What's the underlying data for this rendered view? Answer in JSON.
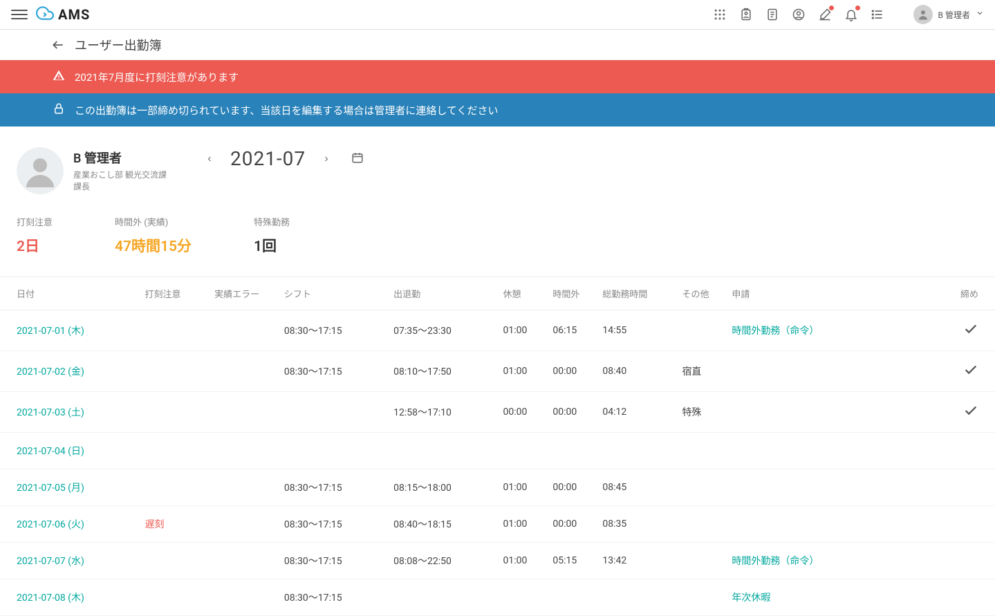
{
  "brand": "AMS",
  "header": {
    "user_name": "B 管理者"
  },
  "page": {
    "title": "ユーザー出勤簿"
  },
  "alerts": {
    "warning": "2021年7月度に打刻注意があります",
    "info": "この出勤簿は一部締め切られています、当該日を編集する場合は管理者に連絡してください"
  },
  "profile": {
    "name": "B 管理者",
    "dept_line1": "産業おこし部 観光交流課",
    "dept_line2": "課長"
  },
  "month": "2021-07",
  "stats": {
    "attention": {
      "label": "打刻注意",
      "value": "2日"
    },
    "overtime": {
      "label": "時間外 (実績)",
      "value": "47時間15分"
    },
    "special": {
      "label": "特殊勤務",
      "value": "1回"
    }
  },
  "columns": {
    "date": "日付",
    "attention": "打刻注意",
    "error": "実績エラー",
    "shift": "シフト",
    "inout": "出退勤",
    "break": "休憩",
    "overtime": "時間外",
    "total": "総勤務時間",
    "other": "その他",
    "application": "申請",
    "close": "締め"
  },
  "rows": [
    {
      "date": "2021-07-01 (木)",
      "attention": "",
      "error": "",
      "shift": "08:30～17:15",
      "inout": "07:35～23:30",
      "break": "01:00",
      "overtime": "06:15",
      "total": "14:55",
      "other": "",
      "application": "時間外勤務（命令）",
      "closed": true
    },
    {
      "date": "2021-07-02 (金)",
      "attention": "",
      "error": "",
      "shift": "08:30～17:15",
      "inout": "08:10～17:50",
      "break": "01:00",
      "overtime": "00:00",
      "total": "08:40",
      "other": "宿直",
      "application": "",
      "closed": true
    },
    {
      "date": "2021-07-03 (土)",
      "attention": "",
      "error": "",
      "shift": "",
      "inout": "12:58～17:10",
      "break": "00:00",
      "overtime": "00:00",
      "total": "04:12",
      "other": "特殊",
      "application": "",
      "closed": true
    },
    {
      "date": "2021-07-04 (日)",
      "attention": "",
      "error": "",
      "shift": "",
      "inout": "",
      "break": "",
      "overtime": "",
      "total": "",
      "other": "",
      "application": "",
      "closed": false
    },
    {
      "date": "2021-07-05 (月)",
      "attention": "",
      "error": "",
      "shift": "08:30～17:15",
      "inout": "08:15～18:00",
      "break": "01:00",
      "overtime": "00:00",
      "total": "08:45",
      "other": "",
      "application": "",
      "closed": false
    },
    {
      "date": "2021-07-06 (火)",
      "attention": "遅刻",
      "error": "",
      "shift": "08:30～17:15",
      "inout": "08:40～18:15",
      "break": "01:00",
      "overtime": "00:00",
      "total": "08:35",
      "other": "",
      "application": "",
      "closed": false
    },
    {
      "date": "2021-07-07 (水)",
      "attention": "",
      "error": "",
      "shift": "08:30～17:15",
      "inout": "08:08～22:50",
      "break": "01:00",
      "overtime": "05:15",
      "total": "13:42",
      "other": "",
      "application": "時間外勤務（命令）",
      "closed": false
    },
    {
      "date": "2021-07-08 (木)",
      "attention": "",
      "error": "",
      "shift": "08:30～17:15",
      "inout": "",
      "break": "",
      "overtime": "",
      "total": "",
      "other": "",
      "application": "年次休暇",
      "closed": false
    }
  ]
}
